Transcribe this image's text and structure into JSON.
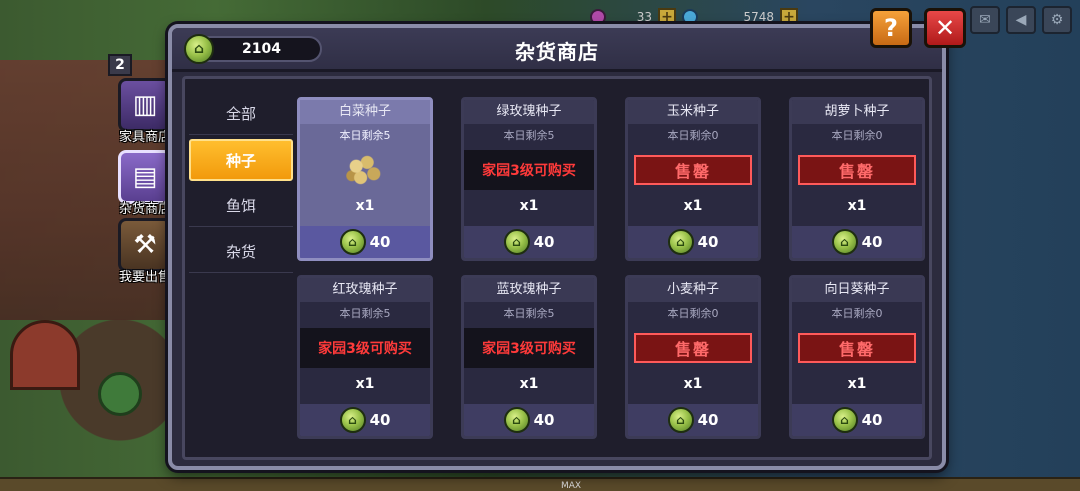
{
  "hud": {
    "gem_value": "33",
    "coin_value": "5748"
  },
  "side_menu": [
    {
      "label": "家具商店",
      "icon": "furniture-shop-icon"
    },
    {
      "label": "杂货商店",
      "icon": "grocery-shop-icon"
    },
    {
      "label": "我要出售",
      "icon": "sell-icon"
    }
  ],
  "house_level": "2",
  "max_label": "MAX",
  "dialog": {
    "title": "杂货商店",
    "currency": "2104",
    "help_label": "?",
    "close_label": "✕"
  },
  "categories": [
    {
      "label": "全部"
    },
    {
      "label": "种子"
    },
    {
      "label": "鱼饵"
    },
    {
      "label": "杂货"
    }
  ],
  "active_category": "种子",
  "items": [
    {
      "name": "白菜种子",
      "stock": "本日剩余5",
      "state": "available",
      "status": "",
      "qty": "x1",
      "price": "40"
    },
    {
      "name": "绿玫瑰种子",
      "stock": "本日剩余5",
      "state": "locked",
      "status": "家园3级可购买",
      "qty": "x1",
      "price": "40"
    },
    {
      "name": "玉米种子",
      "stock": "本日剩余0",
      "state": "soldout",
      "status": "售罄",
      "qty": "x1",
      "price": "40"
    },
    {
      "name": "胡萝卜种子",
      "stock": "本日剩余0",
      "state": "soldout",
      "status": "售罄",
      "qty": "x1",
      "price": "40"
    },
    {
      "name": "红玫瑰种子",
      "stock": "本日剩余5",
      "state": "locked",
      "status": "家园3级可购买",
      "qty": "x1",
      "price": "40"
    },
    {
      "name": "蓝玫瑰种子",
      "stock": "本日剩余5",
      "state": "locked",
      "status": "家园3级可购买",
      "qty": "x1",
      "price": "40"
    },
    {
      "name": "小麦种子",
      "stock": "本日剩余0",
      "state": "soldout",
      "status": "售罄",
      "qty": "x1",
      "price": "40"
    },
    {
      "name": "向日葵种子",
      "stock": "本日剩余0",
      "state": "soldout",
      "status": "售罄",
      "qty": "x1",
      "price": "40"
    }
  ],
  "colors": {
    "accent_orange": "#f29a0c",
    "sold_out_red": "#ff3a3a",
    "currency_green": "#9ac24a"
  }
}
